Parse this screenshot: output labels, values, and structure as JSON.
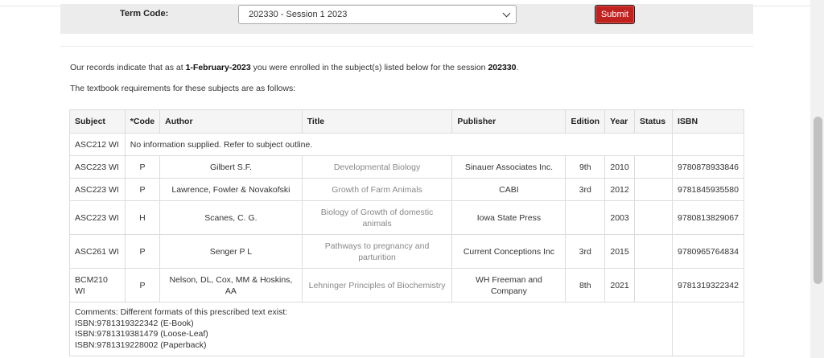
{
  "form": {
    "term_label": "Term Code:",
    "term_value": "202330 - Session 1 2023",
    "submit_label": "Submit"
  },
  "message": {
    "line1_pre": "Our records indicate that as at ",
    "line1_date": "1-February-2023",
    "line1_mid": " you were enrolled in the subject(s) listed below for the session ",
    "line1_session": "202330",
    "line1_end": ".",
    "line2": "The textbook requirements for these subjects are as follows:"
  },
  "table": {
    "headers": {
      "subject": "Subject",
      "code": "*Code",
      "author": "Author",
      "title": "Title",
      "publisher": "Publisher",
      "edition": "Edition",
      "year": "Year",
      "status": "Status",
      "isbn": "ISBN"
    },
    "no_info_subject": "ASC212 WI",
    "no_info_text": "No information supplied. Refer to subject outline.",
    "rows": [
      {
        "subject": "ASC223 WI",
        "code": "P",
        "author": "Gilbert S.F.",
        "title": "Developmental Biology",
        "publisher": "Sinauer Associates Inc.",
        "edition": "9th",
        "year": "2010",
        "status": "",
        "isbn": "9780878933846"
      },
      {
        "subject": "ASC223 WI",
        "code": "P",
        "author": "Lawrence, Fowler & Novakofski",
        "title": "Growth of Farm Animals",
        "publisher": "CABI",
        "edition": "3rd",
        "year": "2012",
        "status": "",
        "isbn": "9781845935580"
      },
      {
        "subject": "ASC223 WI",
        "code": "H",
        "author": "Scanes, C. G.",
        "title": "Biology of Growth of domestic animals",
        "publisher": "Iowa State Press",
        "edition": "",
        "year": "2003",
        "status": "",
        "isbn": "9780813829067"
      },
      {
        "subject": "ASC261 WI",
        "code": "P",
        "author": "Senger P L",
        "title": "Pathways to pregnancy and parturition",
        "publisher": "Current Conceptions Inc",
        "edition": "3rd",
        "year": "2015",
        "status": "",
        "isbn": "9780965764834"
      },
      {
        "subject": "BCM210 WI",
        "code": "P",
        "author": "Nelson, DL, Cox, MM & Hoskins, AA",
        "title": "Lehninger Principles of Biochemistry",
        "publisher": "WH Freeman and Company",
        "edition": "8th",
        "year": "2021",
        "status": "",
        "isbn": "9781319322342"
      }
    ],
    "comments": {
      "line1": "Comments: Different formats of this prescribed text exist:",
      "line2": "ISBN:9781319322342 (E-Book)",
      "line3": "ISBN:9781319381479 (Loose-Leaf)",
      "line4": "ISBN:9781319228002 (Paperback)"
    }
  }
}
